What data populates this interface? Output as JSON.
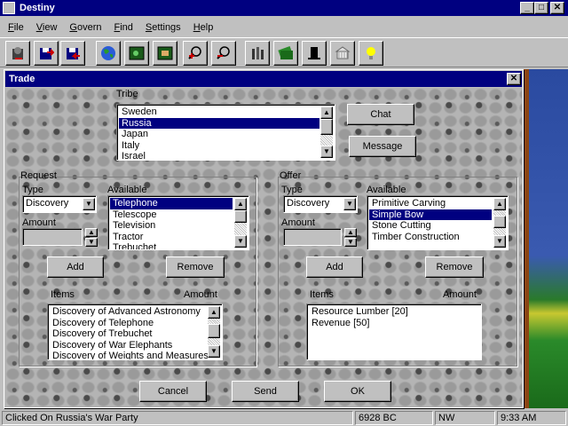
{
  "window": {
    "title": "Destiny",
    "min": "_",
    "max": "□",
    "close": "✕"
  },
  "menu": [
    "File",
    "View",
    "Govern",
    "Find",
    "Settings",
    "Help"
  ],
  "menu_underline": [
    "F",
    "V",
    "G",
    "F",
    "S",
    "H"
  ],
  "toolbar": [
    "exit-icon",
    "save-icon",
    "load-icon",
    "globe-icon",
    "map-icon",
    "city-icon",
    "zoom-in-icon",
    "zoom-out-icon",
    "factory-icon",
    "money-icon",
    "hat-icon",
    "building-icon",
    "lightbulb-icon"
  ],
  "dialog": {
    "title": "Trade",
    "close": "✕",
    "tribe_label": "Tribe",
    "tribes": [
      "Sweden",
      "Russia",
      "Japan",
      "Italy",
      "Israel"
    ],
    "tribe_selected": 1,
    "chat": "Chat",
    "message": "Message",
    "request": {
      "group": "Request",
      "type_label": "Type",
      "type_value": "Discovery",
      "available_label": "Available",
      "amount_label": "Amount",
      "available": [
        "Telephone",
        "Telescope",
        "Television",
        "Tractor",
        "Trebuchet"
      ],
      "selected": 0,
      "add": "Add",
      "remove": "Remove",
      "items_label": "Items",
      "amount_col": "Amount",
      "items": [
        "Discovery of Advanced Astronomy",
        "Discovery of Telephone",
        "Discovery of Trebuchet",
        "Discovery of War Elephants",
        "Discovery of Weights and Measures"
      ]
    },
    "offer": {
      "group": "Offer",
      "type_label": "Type",
      "type_value": "Discovery",
      "available_label": "Available",
      "amount_label": "Amount",
      "available": [
        "Primitive Carving",
        "Simple Bow",
        "Stone Cutting",
        "Timber Construction"
      ],
      "selected": 1,
      "add": "Add",
      "remove": "Remove",
      "items_label": "Items",
      "amount_col": "Amount",
      "items": [
        "Resource Lumber [20]",
        "Revenue [50]"
      ]
    },
    "cancel": "Cancel",
    "send": "Send",
    "ok": "OK"
  },
  "status": {
    "message": "Clicked On Russia's War Party",
    "date": "6928 BC",
    "direction": "NW",
    "time": "9:33 AM"
  }
}
